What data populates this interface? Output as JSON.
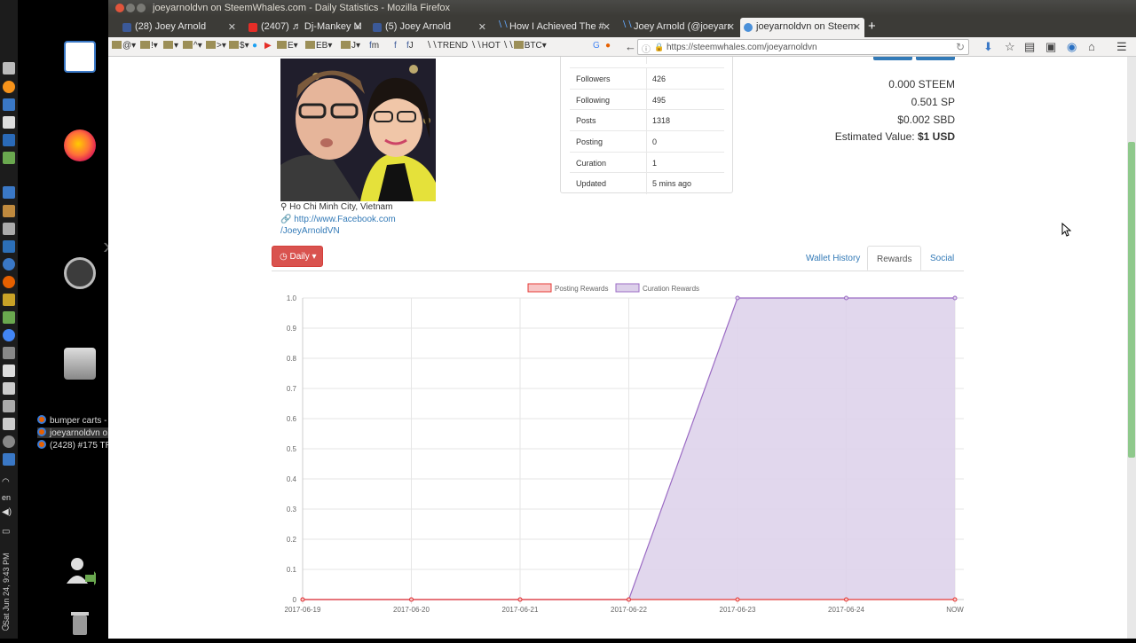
{
  "window": {
    "title": "joeyarnoldvn on SteemWhales.com - Daily Statistics - Mozilla Firefox"
  },
  "tabs": [
    {
      "label": "(28) Joey Arnold",
      "color": "#3b5998"
    },
    {
      "label": "(2407) ♬ Dj-Mankey M",
      "color": "#e52d27"
    },
    {
      "label": "(5) Joey Arnold",
      "color": "#3b5998"
    },
    {
      "label": "How I Achieved The #",
      "color": "#1a5099"
    },
    {
      "label": "Joey Arnold (@joeyarr",
      "color": "#1a5099"
    },
    {
      "label": "joeyarnoldvn on Steem",
      "color": "#4a90d9"
    }
  ],
  "bookmarks": [
    "@",
    "!",
    "",
    "^",
    ">",
    "$",
    "",
    "",
    "E",
    "EB",
    "J",
    "m",
    "",
    "J",
    "TREND",
    "HOT",
    "BTC",
    "G"
  ],
  "url": "https://steemwhales.com/joeyarnoldvn",
  "launcher": {
    "windows": [
      "bumper carts - ...",
      "joeyarnoldvn o...",
      "(2428) #175 TR..."
    ],
    "lang": "en",
    "clock": "Sat Jun 24, 9:43 PM"
  },
  "profile": {
    "location": "Ho Chi Minh City, Vietnam",
    "link_line1": "http://www.Facebook.com",
    "link_line2": "/JoeyArnoldVN"
  },
  "stats": [
    {
      "key": "Followers",
      "value": "426"
    },
    {
      "key": "Following",
      "value": "495"
    },
    {
      "key": "Posts",
      "value": "1318"
    },
    {
      "key": "Posting",
      "value": "0"
    },
    {
      "key": "Curation",
      "value": "1"
    },
    {
      "key": "Updated",
      "value": "5 mins ago"
    }
  ],
  "balances": {
    "steem": "0.000 STEEM",
    "sp": "0.501 SP",
    "sbd": "$0.002 SBD",
    "estimated_label": "Estimated Value:",
    "estimated_value": "$1 USD"
  },
  "controls": {
    "period": "Daily",
    "tabs": [
      "Wallet History",
      "Rewards",
      "Social"
    ],
    "active_tab": "Rewards"
  },
  "chart_data": {
    "type": "area",
    "x": [
      "2017-06-19",
      "2017-06-20",
      "2017-06-21",
      "2017-06-22",
      "2017-06-23",
      "2017-06-24",
      "NOW"
    ],
    "ylim": [
      0,
      1.0
    ],
    "yticks": [
      "1.0",
      "0.9",
      "0.8",
      "0.7",
      "0.6",
      "0.5",
      "0.4",
      "0.3",
      "0.2",
      "0.1",
      "0"
    ],
    "grid": true,
    "legend": "top",
    "series": [
      {
        "name": "Posting Rewards",
        "values": [
          0,
          0,
          0,
          0,
          0,
          0,
          0
        ],
        "color": "#e53935",
        "fill": "#f7c6c6"
      },
      {
        "name": "Curation Rewards",
        "values": [
          0,
          0,
          0,
          0,
          1,
          1,
          1
        ],
        "color": "#9b6bc4",
        "fill": "#dcd0ea"
      }
    ]
  }
}
